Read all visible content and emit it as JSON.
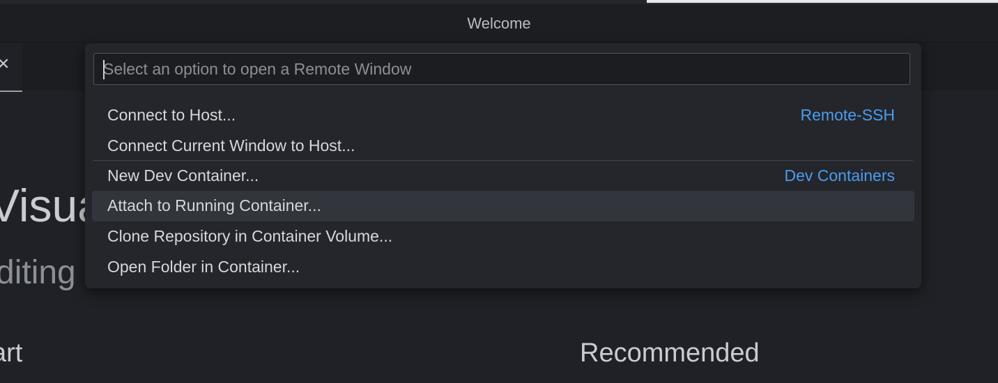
{
  "window": {
    "title": "Welcome"
  },
  "tab": {
    "close_icon": "close-icon"
  },
  "welcome": {
    "heading": "Visua",
    "subheading": "diting",
    "start_heading": "art",
    "recommended_heading": "Recommended"
  },
  "quickpick": {
    "placeholder": "Select an option to open a Remote Window",
    "value": "",
    "items": [
      {
        "label": "Connect to Host...",
        "group": "Remote-SSH"
      },
      {
        "label": "Connect Current Window to Host...",
        "group": ""
      },
      {
        "label": "New Dev Container...",
        "group": "Dev Containers"
      },
      {
        "label": "Attach to Running Container...",
        "group": ""
      },
      {
        "label": "Clone Repository in Container Volume...",
        "group": ""
      },
      {
        "label": "Open Folder in Container...",
        "group": ""
      }
    ],
    "active_index": 3
  },
  "colors": {
    "background": "#1f2126",
    "quickpick_background": "#24262b",
    "group_label": "#4c9bf0",
    "active_item": "#32353b"
  }
}
